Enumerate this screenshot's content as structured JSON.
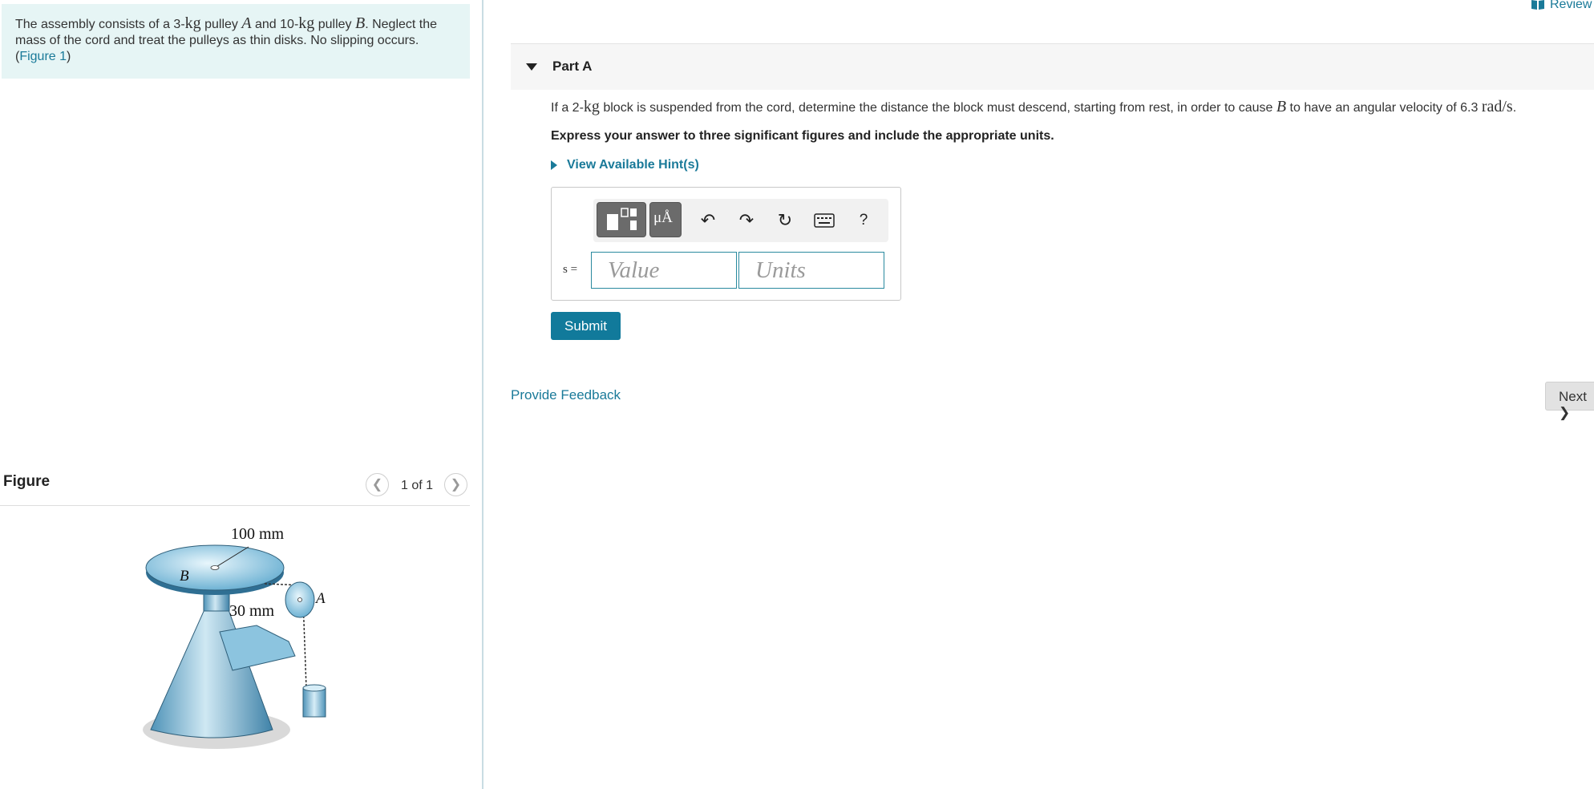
{
  "problem": {
    "text_1": "The assembly consists of a 3-",
    "unit_kg_1": "kg",
    "text_2": " pulley ",
    "var_A": "A",
    "text_3": " and 10-",
    "unit_kg_2": "kg",
    "text_4": " pulley ",
    "var_B": "B",
    "text_5": ". Neglect the mass of the cord and treat the pulleys as thin disks. No slipping occurs.",
    "paren_open": "(",
    "figure_link": "Figure 1",
    "paren_close": ")"
  },
  "figure": {
    "title": "Figure",
    "prev_icon": "chevron-left-icon",
    "next_icon": "chevron-right-icon",
    "counter": "1 of 1",
    "labels": {
      "radius_b": "100 mm",
      "radius_a": "30 mm",
      "label_a": "A",
      "label_b": "B"
    }
  },
  "header": {
    "review_label": "Review",
    "review_icon": "book-icon"
  },
  "part": {
    "title": "Part A",
    "question": {
      "t1": "If a 2-",
      "kg": "kg",
      "t2": " block is suspended from the cord, determine the distance the block must descend, starting from rest, in order to cause ",
      "B": "B",
      "t3": " to have an angular velocity of 6.3 ",
      "unit": "rad/s",
      "t4": "."
    },
    "instructions": "Express your answer to three significant figures and include the appropriate units.",
    "hint_label": "View Available Hint(s)",
    "toolbar": {
      "templates_icon": "templates-icon",
      "units_icon": "units-mu-angstrom-icon",
      "units_text": "μÅ",
      "undo_icon": "undo-icon",
      "redo_icon": "redo-icon",
      "reset_icon": "reset-icon",
      "keyboard_icon": "keyboard-icon",
      "help_label": "?"
    },
    "variable_label": "s =",
    "value_placeholder": "Value",
    "units_placeholder": "Units",
    "submit_label": "Submit"
  },
  "footer": {
    "feedback_label": "Provide Feedback",
    "next_label": "Next ❯"
  },
  "colors": {
    "accent": "#117a9b",
    "link": "#1a7a99",
    "problem_bg": "#e6f5f5",
    "input_border": "#2a8a9f"
  }
}
